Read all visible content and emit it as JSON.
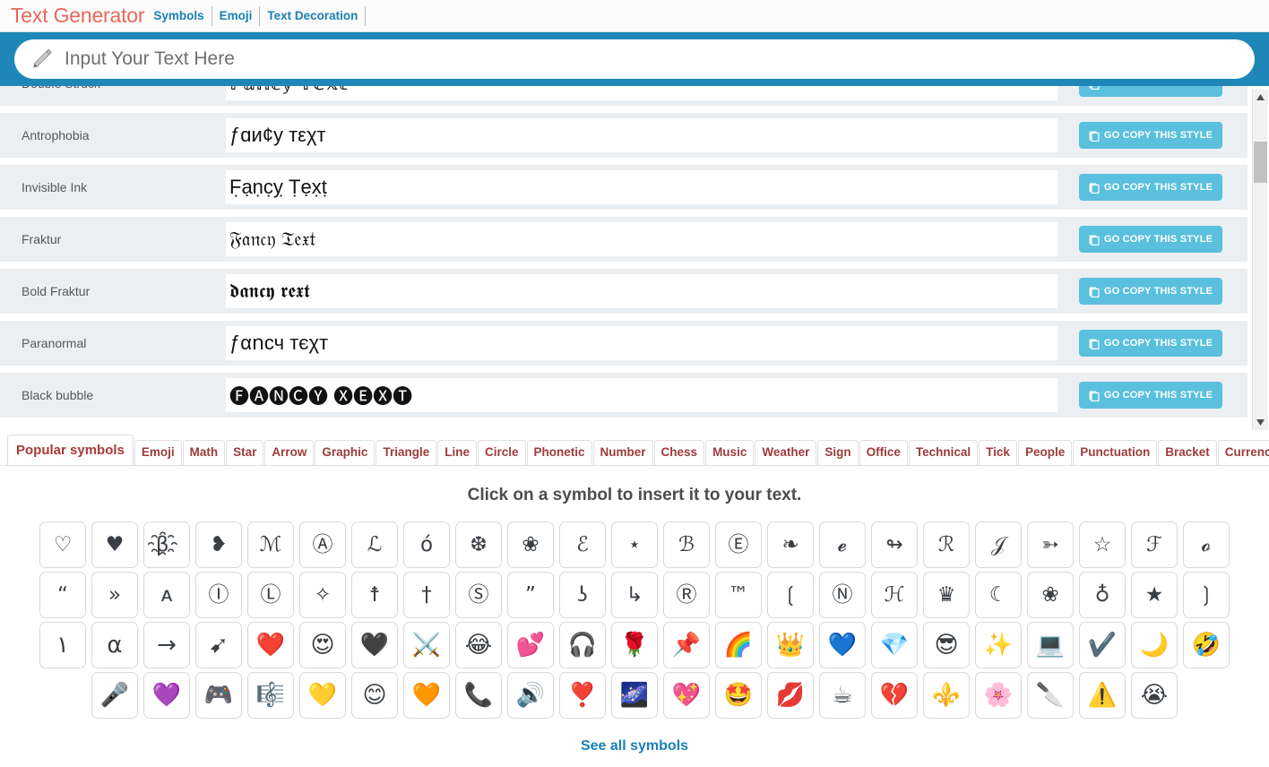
{
  "header": {
    "brand": "Text Generator",
    "links": [
      {
        "label": "Symbols"
      },
      {
        "label": "Emoji"
      },
      {
        "label": "Text Decoration"
      }
    ]
  },
  "input": {
    "placeholder": "Input Your Text Here",
    "value": "",
    "icon": "pencil-icon",
    "bar_color": "#1f87b8"
  },
  "style_list": {
    "copy_button_label": "GO COPY THIS STYLE",
    "copy_button_color": "#5bc0de",
    "rows": [
      {
        "name": "Double Struck",
        "preview": "𝔽𝕒𝕟𝕔𝕪 𝕋𝕖𝕩𝕥"
      },
      {
        "name": "Antrophobia",
        "preview": "ƒɑи¢у тεχт"
      },
      {
        "name": "Invisible Ink",
        "preview": "F̣ạṇc̣ỵ Ṭẹx̣ṭ"
      },
      {
        "name": "Fraktur",
        "preview": "𝔉𝔞𝔫𝔠𝔶 𝔗𝔢𝔵𝔱"
      },
      {
        "name": "Bold Fraktur",
        "preview": "𝖉𝖆𝖓𝖈𝖞 𝖗𝖊𝖝𝖙"
      },
      {
        "name": "Paranormal",
        "preview": "ƒαոсч тєχт"
      },
      {
        "name": "Black bubble",
        "preview": "🅕🅐🅝🅒🅨 🅧🅔🅧🅣"
      }
    ],
    "scrollbar": {
      "up_arrow": "▲",
      "down_arrow": "▼"
    }
  },
  "tabs": {
    "active": "Popular symbols",
    "items": [
      "Popular symbols",
      "Emoji",
      "Math",
      "Star",
      "Arrow",
      "Graphic",
      "Triangle",
      "Line",
      "Circle",
      "Phonetic",
      "Number",
      "Chess",
      "Music",
      "Weather",
      "Sign",
      "Office",
      "Technical",
      "Tick",
      "People",
      "Punctuation",
      "Bracket",
      "Currency"
    ]
  },
  "symbol_panel": {
    "title": "Click on a symbol to insert it to your text.",
    "see_all_label": "See all symbols",
    "rows": [
      [
        "♡",
        "♥",
        "β҈",
        "❥",
        "ℳ",
        "Ⓐ",
        "ℒ",
        "ό",
        "❆",
        "❀",
        "ℰ",
        "⋆",
        "ℬ",
        "Ⓔ",
        "❧",
        "𝓮",
        "↬",
        "ℛ",
        "𝒥",
        "➳",
        "☆",
        "ℱ",
        "𝓸"
      ],
      [
        "“",
        "»",
        "ᴀ",
        "Ⓘ",
        "Ⓛ",
        "✧",
        "☨",
        "†",
        "Ⓢ",
        "”",
        "ʖ",
        "↳",
        "Ⓡ",
        "™",
        "❲",
        "Ⓝ",
        "ℋ",
        "♛",
        "☾",
        "❀",
        "♁",
        "★",
        "❳"
      ],
      [
        "١",
        "α",
        "→",
        "➹",
        "❤️",
        "😍",
        "🖤",
        "⚔️",
        "😂",
        "💕",
        "🎧",
        "🌹",
        "📌",
        "🌈",
        "👑",
        "💙",
        "💎",
        "😎",
        "✨",
        "💻",
        "✔️",
        "🌙",
        "🤣"
      ],
      [
        "🎤",
        "💜",
        "🎮",
        "🎼",
        "💛",
        "😊",
        "🧡",
        "📞",
        "🔊",
        "❣️",
        "🌌",
        "💖",
        "🤩",
        "💋",
        "☕",
        "💔",
        "⚜️",
        "🌸",
        "🔪",
        "⚠️",
        "😭"
      ]
    ]
  }
}
